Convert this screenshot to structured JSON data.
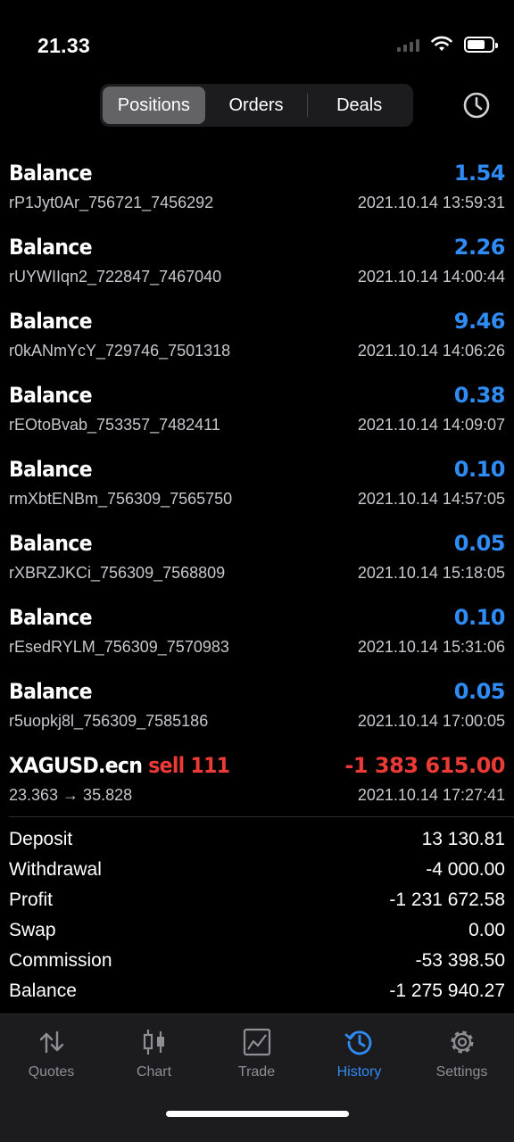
{
  "status_bar": {
    "time": "21.33"
  },
  "segments": [
    {
      "label": "Positions",
      "active": true
    },
    {
      "label": "Orders",
      "active": false
    },
    {
      "label": "Deals",
      "active": false
    }
  ],
  "deals": [
    {
      "title": "Balance",
      "amount": "1.54",
      "sub": "rP1Jyt0Ar_756721_7456292",
      "date": "2021.10.14 13:59:31"
    },
    {
      "title": "Balance",
      "amount": "2.26",
      "sub": "rUYWIIqn2_722847_7467040",
      "date": "2021.10.14 14:00:44"
    },
    {
      "title": "Balance",
      "amount": "9.46",
      "sub": "r0kANmYcY_729746_7501318",
      "date": "2021.10.14 14:06:26"
    },
    {
      "title": "Balance",
      "amount": "0.38",
      "sub": "rEOtoBvab_753357_7482411",
      "date": "2021.10.14 14:09:07"
    },
    {
      "title": "Balance",
      "amount": "0.10",
      "sub": "rmXbtENBm_756309_7565750",
      "date": "2021.10.14 14:57:05"
    },
    {
      "title": "Balance",
      "amount": "0.05",
      "sub": "rXBRZJKCi_756309_7568809",
      "date": "2021.10.14 15:18:05"
    },
    {
      "title": "Balance",
      "amount": "0.10",
      "sub": "rEsedRYLM_756309_7570983",
      "date": "2021.10.14 15:31:06"
    },
    {
      "title": "Balance",
      "amount": "0.05",
      "sub": "r5uopkj8l_756309_7585186",
      "date": "2021.10.14 17:00:05"
    }
  ],
  "trade": {
    "symbol": "XAGUSD.ecn",
    "side": "sell 111",
    "amount": "-1 383 615.00",
    "prices": "23.363 → 35.828",
    "date": "2021.10.14 17:27:41"
  },
  "summary": [
    {
      "label": "Deposit",
      "value": "13 130.81"
    },
    {
      "label": "Withdrawal",
      "value": "-4 000.00"
    },
    {
      "label": "Profit",
      "value": "-1 231 672.58"
    },
    {
      "label": "Swap",
      "value": "0.00"
    },
    {
      "label": "Commission",
      "value": "-53 398.50"
    },
    {
      "label": "Balance",
      "value": "-1 275 940.27"
    }
  ],
  "tabs": [
    {
      "label": "Quotes",
      "icon": "quotes-icon"
    },
    {
      "label": "Chart",
      "icon": "chart-icon"
    },
    {
      "label": "Trade",
      "icon": "trade-icon"
    },
    {
      "label": "History",
      "icon": "history-icon",
      "active": true
    },
    {
      "label": "Settings",
      "icon": "settings-icon"
    }
  ],
  "colors": {
    "positive": "#2f8cf5",
    "negative": "#ec3b37",
    "active_tab": "#2f8cf5"
  }
}
